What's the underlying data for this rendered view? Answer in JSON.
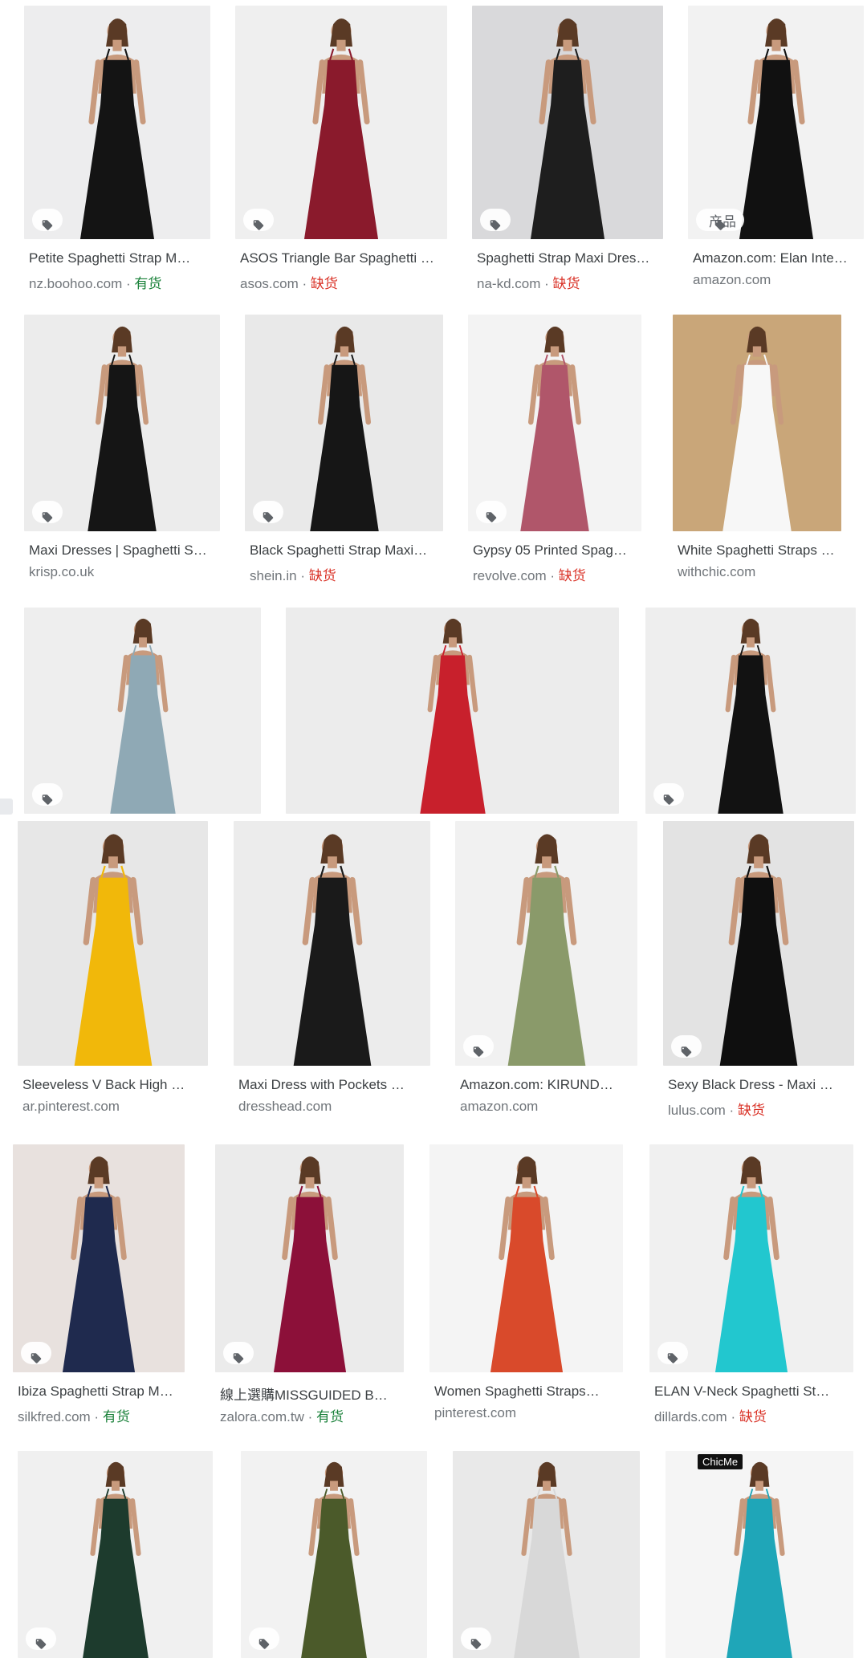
{
  "results": [
    {
      "title": "Petite Spaghetti Strap M…",
      "source": "nz.boohoo.com",
      "availability": "有货",
      "avail_class": "in",
      "tag_label": "",
      "bg": "#ededee",
      "dress_color": "#141414"
    },
    {
      "title": "ASOS Triangle Bar Spaghetti …",
      "source": "asos.com",
      "availability": "缺货",
      "avail_class": "out",
      "tag_label": "",
      "bg": "#efefef",
      "dress_color": "#8a1a2c"
    },
    {
      "title": "Spaghetti Strap Maxi Dres…",
      "source": "na-kd.com",
      "availability": "缺货",
      "avail_class": "out",
      "tag_label": "",
      "bg": "#d9d9db",
      "dress_color": "#1e1e1e"
    },
    {
      "title": "Amazon.com: Elan Inte…",
      "source": "amazon.com",
      "availability": "",
      "avail_class": "",
      "tag_label": "产品",
      "bg": "#f2f2f2",
      "dress_color": "#111111"
    },
    {
      "title": "Maxi Dresses | Spaghetti S…",
      "source": "krisp.co.uk",
      "availability": "",
      "avail_class": "",
      "tag_label": "",
      "bg": "#ececec",
      "dress_color": "#151515"
    },
    {
      "title": "Black Spaghetti Strap Maxi…",
      "source": "shein.in",
      "availability": "缺货",
      "avail_class": "out",
      "tag_label": "",
      "bg": "#e9e9e9",
      "dress_color": "#161616"
    },
    {
      "title": "Gypsy 05 Printed Spag…",
      "source": "revolve.com",
      "availability": "缺货",
      "avail_class": "out",
      "tag_label": "",
      "bg": "#f3f3f3",
      "dress_color": "#b0566a"
    },
    {
      "title": "White Spaghetti Straps L…",
      "source": "withchic.com",
      "availability": "",
      "avail_class": "",
      "tag_label": "",
      "bg": "#c9a679",
      "dress_color": "#f7f7f7"
    },
    {
      "title": "",
      "source": "",
      "availability": "",
      "avail_class": "",
      "tag_label": "",
      "bg": "#eeeeee",
      "dress_color": "#8fa9b5"
    },
    {
      "title": "",
      "source": "",
      "availability": "",
      "avail_class": "",
      "tag_label": "",
      "bg": "#ececec",
      "dress_color": "#c8202c"
    },
    {
      "title": "",
      "source": "",
      "availability": "",
      "avail_class": "",
      "tag_label": "",
      "bg": "#eeeeee",
      "dress_color": "#121212"
    },
    {
      "title": "Sleeveless V Back High …",
      "source": "ar.pinterest.com",
      "availability": "",
      "avail_class": "",
      "tag_label": "",
      "bg": "#e7e7e7",
      "dress_color": "#f1b80a"
    },
    {
      "title": "Maxi Dress with Pockets …",
      "source": "dresshead.com",
      "availability": "",
      "avail_class": "",
      "tag_label": "",
      "bg": "#ececec",
      "dress_color": "#1a1a1a"
    },
    {
      "title": "Amazon.com: KIRUND…",
      "source": "amazon.com",
      "availability": "",
      "avail_class": "",
      "tag_label": "",
      "bg": "#f1f1f1",
      "dress_color": "#8a9a6a"
    },
    {
      "title": "Sexy Black Dress - Maxi …",
      "source": "lulus.com",
      "availability": "缺货",
      "avail_class": "out",
      "tag_label": "",
      "bg": "#e3e3e3",
      "dress_color": "#0f0f0f"
    },
    {
      "title": "Ibiza Spaghetti Strap M…",
      "source": "silkfred.com",
      "availability": "有货",
      "avail_class": "in",
      "tag_label": "",
      "bg": "#e8e1de",
      "dress_color": "#1f2a4e"
    },
    {
      "title": "線上選購MISSGUIDED B…",
      "source": "zalora.com.tw",
      "availability": "有货",
      "avail_class": "in",
      "tag_label": "",
      "bg": "#ebebeb",
      "dress_color": "#8c1039"
    },
    {
      "title": "Women Spaghetti Straps…",
      "source": "pinterest.com",
      "availability": "",
      "avail_class": "",
      "tag_label": "",
      "bg": "#f4f4f4",
      "dress_color": "#d94a2b"
    },
    {
      "title": "ELAN V-Neck Spaghetti St…",
      "source": "dillards.com",
      "availability": "缺货",
      "avail_class": "out",
      "tag_label": "",
      "bg": "#f0f0f0",
      "dress_color": "#22c7cf"
    },
    {
      "title": "",
      "source": "",
      "availability": "",
      "avail_class": "",
      "tag_label": "",
      "bg": "#f0f0f0",
      "dress_color": "#1d3b2d"
    },
    {
      "title": "",
      "source": "",
      "availability": "",
      "avail_class": "",
      "tag_label": "",
      "bg": "#f2f2f2",
      "dress_color": "#4b5a2a"
    },
    {
      "title": "",
      "source": "",
      "availability": "",
      "avail_class": "",
      "tag_label": "",
      "bg": "#e9e9e9",
      "dress_color": "#d8d8d8"
    },
    {
      "title": "",
      "source": "",
      "availability": "",
      "avail_class": "",
      "tag_label": "",
      "bg": "#f5f5f5",
      "dress_color": "#1fa6b8"
    }
  ],
  "badge_text": "ChicMe",
  "separator": "·"
}
